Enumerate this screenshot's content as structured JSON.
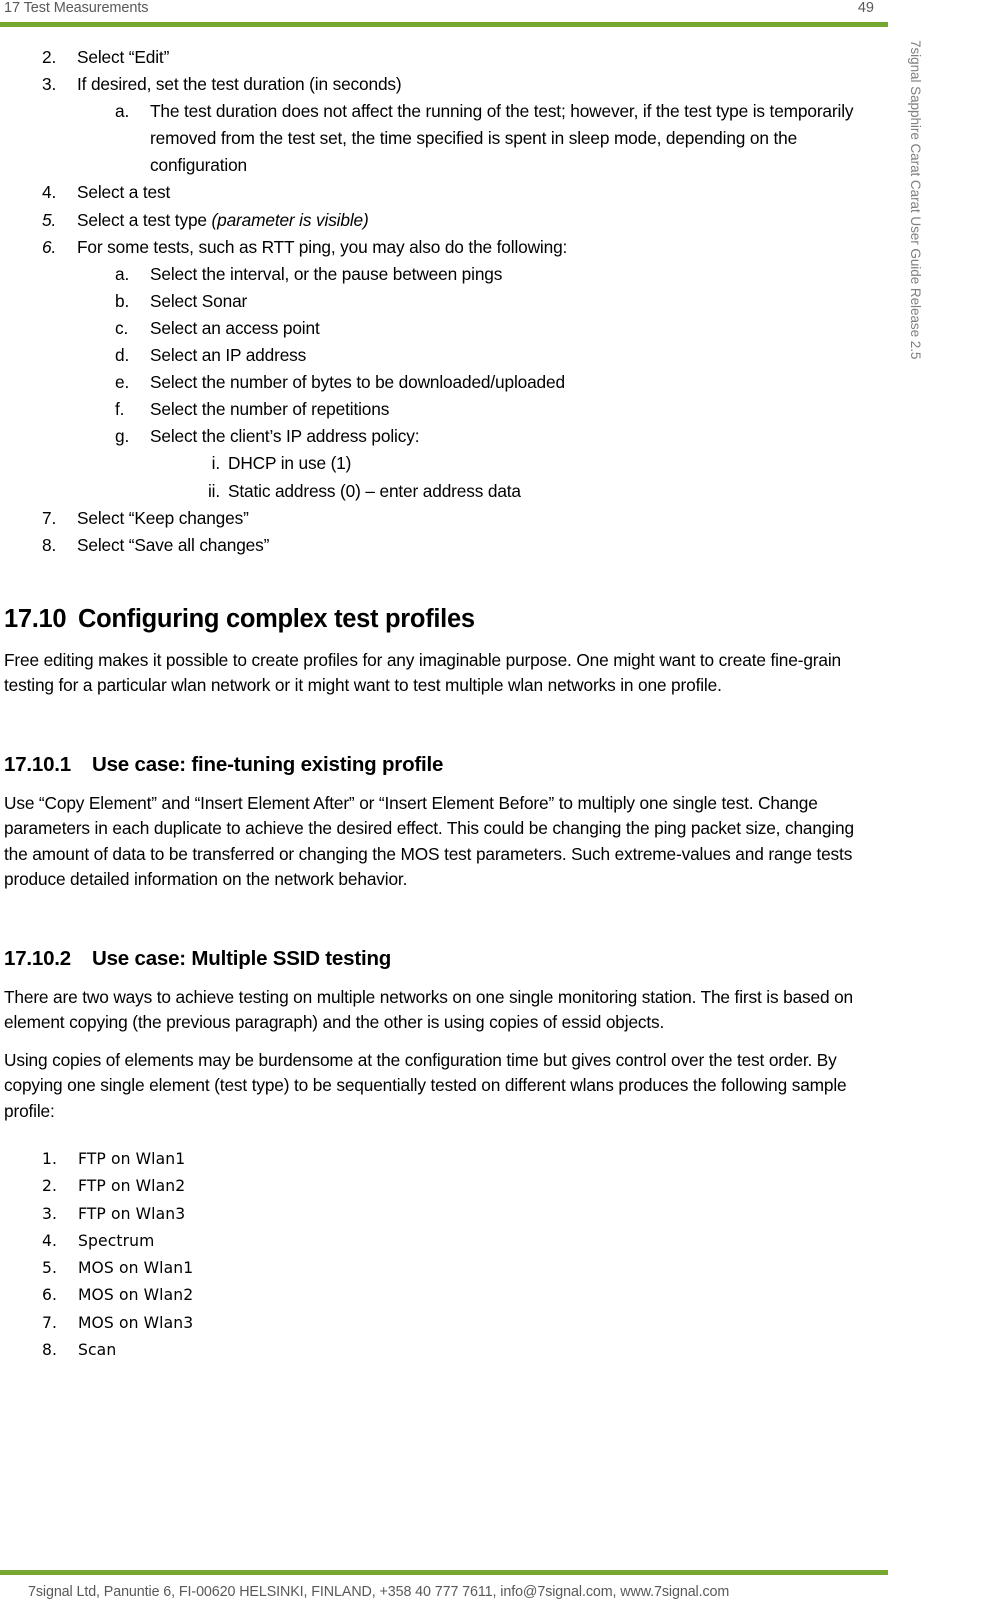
{
  "header": {
    "title": "17 Test Measurements",
    "page_number": "49",
    "rule_color": "#76a831"
  },
  "side_rail": {
    "text": "7signal Sapphire Carat Carat User Guide Release 2.5"
  },
  "procedure_list": {
    "items": [
      {
        "marker": "2.",
        "text": "Select “Edit”"
      },
      {
        "marker": "3.",
        "text": "If desired, set the test duration (in seconds)"
      },
      {
        "marker": "a.",
        "text": "The test duration does not affect the running of the test; however, if the test type is temporarily removed from the test set, the time specified is spent in sleep mode, depending on the configuration"
      },
      {
        "marker": "4.",
        "text": "Select a test"
      },
      {
        "marker": "5.",
        "text": "Select a test type ",
        "text_italic": "(parameter is visible)"
      },
      {
        "marker": "6.",
        "text": "For some tests, such as RTT ping, you may also do the following:"
      },
      {
        "marker": "a.",
        "text": "Select the interval, or the pause between pings"
      },
      {
        "marker": "b.",
        "text": "Select Sonar"
      },
      {
        "marker": "c.",
        "text": "Select an access point"
      },
      {
        "marker": "d.",
        "text": "Select an IP address"
      },
      {
        "marker": "e.",
        "text": "Select the number of bytes to be downloaded/uploaded"
      },
      {
        "marker": "f.",
        "text": "Select the number of repetitions"
      },
      {
        "marker": "g.",
        "text": "Select the client’s IP address policy:"
      },
      {
        "marker": "i.",
        "text": "DHCP in use (1)"
      },
      {
        "marker": "ii.",
        "text": "Static address (0) – enter address data"
      },
      {
        "marker": "7.",
        "text": "Select “Keep changes”"
      },
      {
        "marker": "8.",
        "text": "Select “Save all changes”"
      }
    ]
  },
  "section_17_10": {
    "number": "17.10",
    "title": "Configuring complex test profiles",
    "paragraph": "Free editing makes it possible to create profiles for any imaginable purpose. One might want to create fine-grain testing for a particular wlan network or it might want to test multiple wlan networks in one profile."
  },
  "section_17_10_1": {
    "number": "17.10.1",
    "title": "Use case: fine-tuning existing profile",
    "paragraph": "Use “Copy Element” and “Insert Element After” or “Insert Element Before” to multiply one single test. Change parameters in each duplicate to achieve the desired effect. This could be changing the ping packet size, changing the amount of data to be transferred or changing the MOS test parameters. Such extreme-values and range tests produce detailed information on the network behavior."
  },
  "section_17_10_2": {
    "number": "17.10.2",
    "title": "Use case: Multiple SSID testing",
    "paragraph_1": "There are two ways to achieve testing on multiple networks on one single monitoring station. The first is based on element copying (the previous paragraph) and the other is using copies of essid objects.",
    "paragraph_2": "Using copies of elements may be burdensome at the configuration time but gives control over the test order. By copying one single element (test type) to be sequentially tested on different wlans produces the following sample profile:"
  },
  "sample_profile_list": {
    "items": [
      {
        "marker": "1.",
        "text": "FTP on Wlan1"
      },
      {
        "marker": "2.",
        "text": "FTP on Wlan2"
      },
      {
        "marker": "3.",
        "text": "FTP on Wlan3"
      },
      {
        "marker": "4.",
        "text": "Spectrum"
      },
      {
        "marker": "5.",
        "text": "MOS on Wlan1"
      },
      {
        "marker": "6.",
        "text": "MOS on Wlan2"
      },
      {
        "marker": "7.",
        "text": "MOS on Wlan3"
      },
      {
        "marker": "8.",
        "text": "Scan"
      }
    ]
  },
  "footer": {
    "text": "7signal Ltd, Panuntie 6, FI-00620 HELSINKI, FINLAND, +358 40 777 7611, info@7signal.com, www.7signal.com",
    "rule_color": "#76a831"
  }
}
